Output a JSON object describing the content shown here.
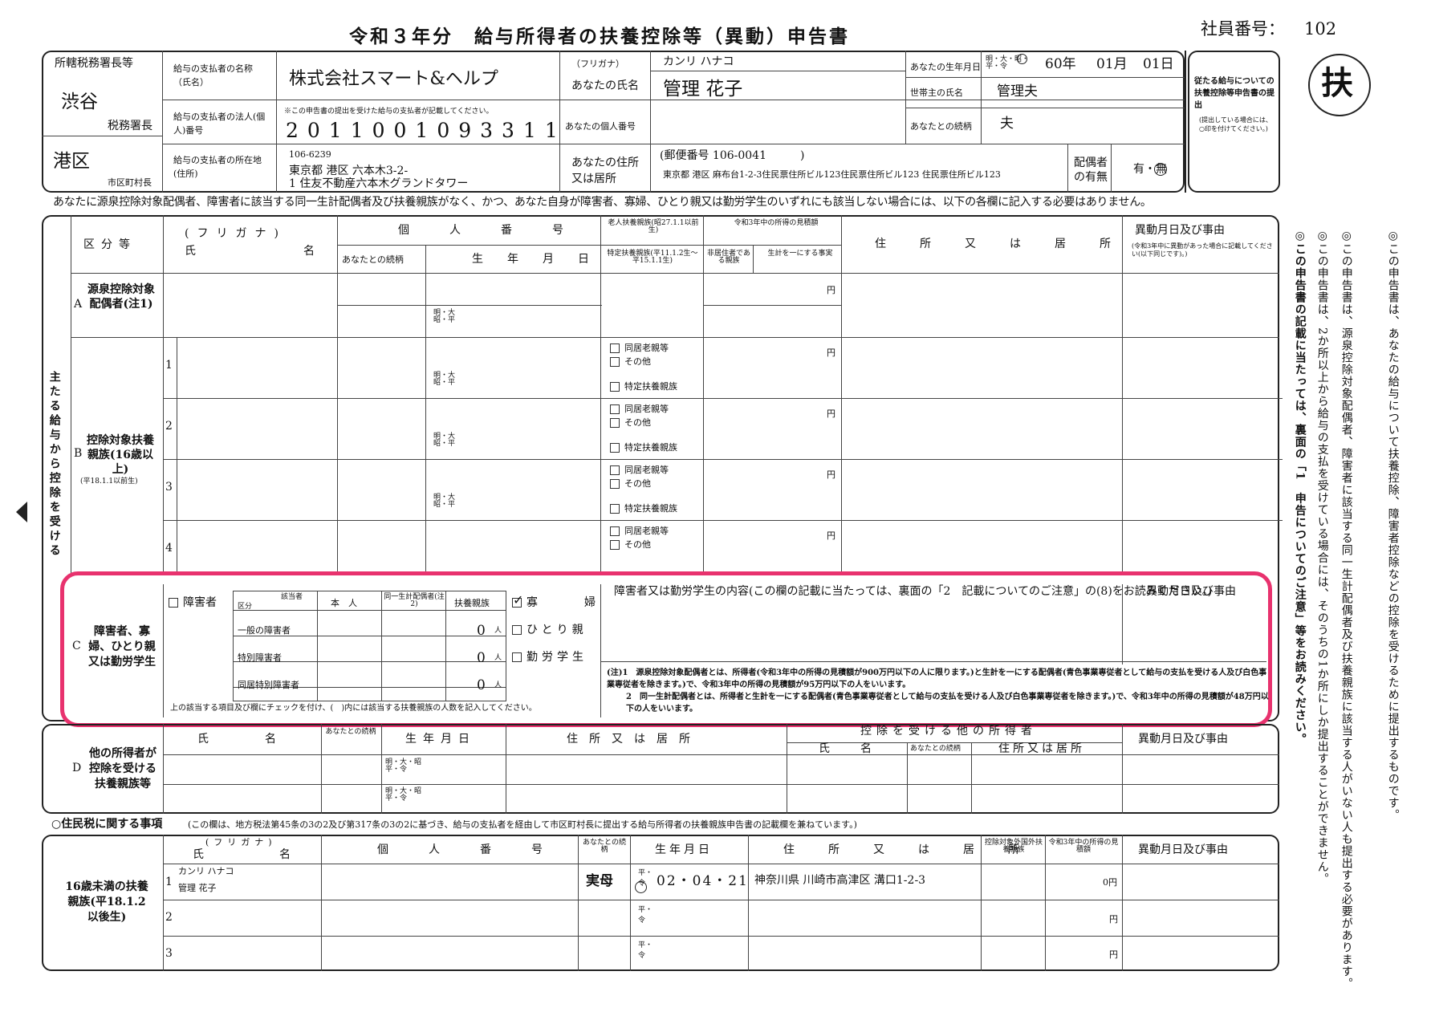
{
  "title": "令和３年分　給与所得者の扶養控除等（異動）申告書",
  "employee_no_label": "社員番号：",
  "employee_no": "102",
  "fu_mark": "扶",
  "header": {
    "tax_office_label": "所轄税務署長等",
    "tax_office": "渋谷",
    "tax_office_suffix": "税務署長",
    "city": "港区",
    "city_suffix": "市区町村長",
    "payer_name_label": "給与の支払者の名称（氏名）",
    "payer_name": "株式会社スマート&ヘルプ",
    "payer_no_label": "給与の支払者の法人(個人)番号",
    "payer_no_note": "※この申告書の提出を受けた給与の支払者が記載してください。",
    "payer_no": "2011001093311",
    "payer_addr_label": "給与の支払者の所在地(住所)",
    "payer_zip": "106-6239",
    "payer_addr1": "東京都 港区 六本木3-2-",
    "payer_addr2": "1 住友不動産六本木グランドタワー",
    "furigana_label": "（フリガナ）",
    "furigana": "カンリ ハナコ",
    "name_label": "あなたの氏名",
    "name": "管理 花子",
    "mynumber_label": "あなたの個人番号",
    "address_label": "あなたの住所又は居所",
    "zip_line": "(郵便番号 106-0041　　　)",
    "address": "東京都 港区 麻布台1-2-3住民票住所ビル123住民票住所ビル123 住民票住所ビル123",
    "birth_label": "あなたの生年月日",
    "era": "明・大・昭・平・令",
    "birth_year": "60年",
    "birth_month": "01月",
    "birth_day": "01日",
    "householder_label": "世帯主の氏名",
    "householder": "管理夫",
    "relation_label": "あなたとの続柄",
    "relation": "夫",
    "spouse_label": "配偶者の有無",
    "spouse_value": "有・無",
    "submit_box_title": "従たる給与についての扶養控除等申告書の提出",
    "submit_box_note": "(提出している場合には、○印を付けてください。)"
  },
  "notice": "あなたに源泉控除対象配偶者、障害者に該当する同一生計配偶者及び扶養親族がなく、かつ、あなた自身が障害者、寡婦、ひとり親又は勤労学生のいずれにも該当しない場合には、以下の各欄に記入する必要はありません。",
  "side_label": "主たる給与から控除を受ける",
  "main_table": {
    "col_kubun": "区分等",
    "col_furigana": "(フリガナ)",
    "col_shimei": "氏　名",
    "col_kojin": "個　人　番　号",
    "col_zokugara": "あなたとの続柄",
    "col_birth": "生　年　月　日",
    "col_rojin": "老人扶養親族(昭27.1.1以前生)",
    "col_tokutei": "特定扶養親族(平11.1.2生〜平15.1.1生)",
    "col_shotoku": "令和3年中の所得の見積額",
    "col_hikyoju": "非居住者である親族",
    "col_seikei": "生計を一にする事実",
    "col_jusho": "住　所　又　は　居　所",
    "col_ido": "異動月日及び事由",
    "col_ido_note": "(令和3年中に異動があった場合に記載してください(以下同じです)。)",
    "rowA": "源泉控除対象配偶者(注1)",
    "rowA_letter": "A",
    "rowB": "控除対象扶養親族(16歳以上)",
    "rowB_note": "(平18.1.1以前生)",
    "rowB_letter": "B",
    "era_small": "明・大昭・平",
    "yen": "円",
    "doukyo": "同居老親等",
    "sonota": "その他",
    "tokutei": "特定扶養親族"
  },
  "sectionC": {
    "letter": "C",
    "label": "障害者、寡婦、ひとり親又は勤労学生",
    "shogaisha": "障害者",
    "gaito": "該当者",
    "kubun": "区分",
    "honnin": "本　人",
    "doitsu": "同一生計配偶者(注2)",
    "fuyo": "扶養親族",
    "ippan": "一般の障害者",
    "tokubetsu": "特別障害者",
    "doukyo_tokubetsu": "同居特別障害者",
    "count": "0",
    "nin": "人",
    "kafu": "寡　婦",
    "hitorioya": "ひとり親",
    "kinro": "勤労学生",
    "check_note": "上の該当する項目及び欄にチェックを付け、(　)内には該当する扶養親族の人数を記入してください。",
    "naiyo": "障害者又は勤労学生の内容(この欄の記載に当たっては、裏面の「2　記載についてのご注意」の(8)をお読みください。)",
    "ido": "異動月日及び事由",
    "note1": "(注)1　源泉控除対象配偶者とは、所得者(令和3年中の所得の見積額が900万円以下の人に限ります。)と生計を一にする配偶者(青色事業専従者として給与の支払を受ける人及び白色事業専従者を除きます。)で、令和3年中の所得の見積額が95万円以下の人をいいます。",
    "note2": "2　同一生計配偶者とは、所得者と生計を一にする配偶者(青色事業専従者として給与の支払を受ける人及び白色事業専従者を除きます。)で、令和3年中の所得の見積額が48万円以下の人をいいます。"
  },
  "sectionD": {
    "letter": "D",
    "label": "他の所得者が控除を受ける扶養親族等",
    "shimei": "氏　　名",
    "zokugara": "あなたとの続柄",
    "birth": "生年月日",
    "jusho": "住所又は居所",
    "other": "控除を受ける他の所得者",
    "other_shimei": "氏　名",
    "other_zoku": "あなたとの続柄",
    "other_jusho": "住所又は居所",
    "ido": "異動月日及び事由",
    "era": "明・大・昭平・令"
  },
  "resident": {
    "title": "○住民税に関する事項",
    "note": "(この欄は、地方税法第45条の3の2及び第317条の3の2に基づき、給与の支払者を経由して市区町村長に提出する給与所得者の扶養親族申告書の記載欄を兼ねています。)",
    "label": "16歳未満の扶養親族(平18.1.2以後生)",
    "furigana": "(フリガナ)",
    "shimei": "氏　名",
    "kojin": "個　人　番　号",
    "zokugara": "あなたとの続柄",
    "birth": "生年月日",
    "jusho": "住　所　又　は　居　所",
    "kokugai": "控除対象外国外扶養親族",
    "mitsumori": "令和3年中の所得の見積額",
    "ido": "異動月日及び事由",
    "child_kana": "カンリ ハナコ",
    "child_name": "管理 花子",
    "child_rel": "実母",
    "child_era": "平・令",
    "child_birth": "02・04・21",
    "child_addr": "神奈川県 川崎市高津区 溝口1-2-3",
    "child_income": "0円",
    "yen": "円"
  },
  "right_notes": [
    "◎この申告書は、あなたの給与について扶養控除、障害者控除などの控除を受けるために提出するものです。",
    "◎この申告書は、源泉控除対象配偶者、障害者に該当する同一生計配偶者及び扶養親族に該当する人がいない人も提出する必要があります。",
    "◎この申告書は、2か所以上から給与の支払を受けている場合には、そのうちの1か所にしか提出することができません。",
    "◎この申告書の記載に当たっては、裏面の「1　申告についてのご注意」等をお読みください。"
  ],
  "colors": {
    "highlight": "#e8326e",
    "line": "#222"
  }
}
